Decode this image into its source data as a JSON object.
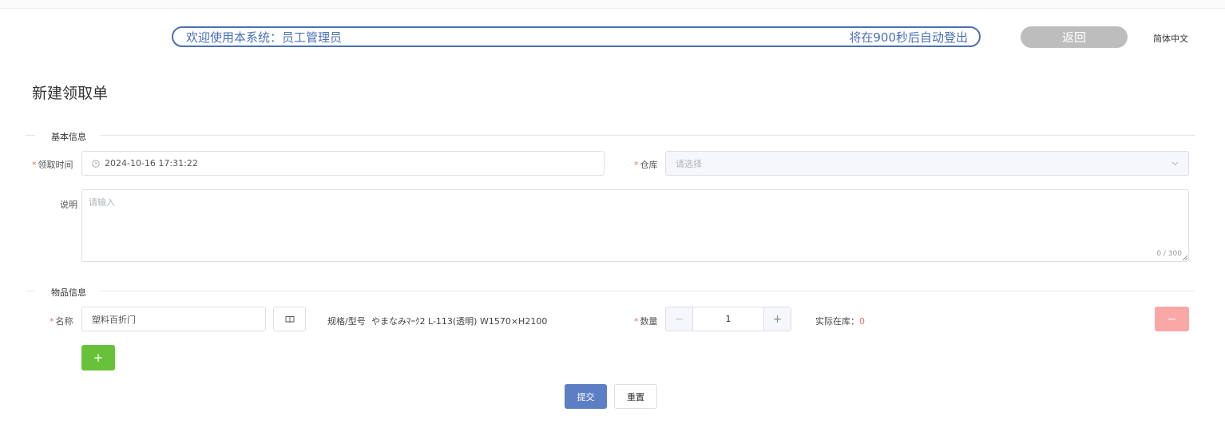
{
  "header": {
    "welcome_text": "欢迎使用本系统：员工管理员",
    "logout_text": "将在900秒后自动登出",
    "back_label": "返回",
    "language_label": "简体中文"
  },
  "page": {
    "title": "新建领取单"
  },
  "basic_section": {
    "title": "基本信息",
    "time_label": "领取时间",
    "time_value": "2024-10-16 17:31:22",
    "warehouse_label": "仓库",
    "warehouse_placeholder": "请选择",
    "note_label": "说明",
    "note_placeholder": "请输入",
    "note_counter": "0 / 300"
  },
  "item_section": {
    "title": "物品信息",
    "name_label": "名称",
    "name_value": "塑料百折门",
    "spec_label": "规格/型号",
    "spec_value": "やまなみﾏｰｸ2 L-113(透明) W1570×H2100",
    "qty_label": "数量",
    "qty_value": "1",
    "qty_minus": "−",
    "qty_plus": "+",
    "stock_label": "实际在库：",
    "stock_value": "0",
    "remove_label": "−",
    "add_label": "+"
  },
  "actions": {
    "submit_label": "提交",
    "reset_label": "重置"
  },
  "colors": {
    "primary": "#5b7ec4",
    "success": "#67c23a",
    "danger_light": "#f9a7a7",
    "required": "#f56c6c"
  }
}
